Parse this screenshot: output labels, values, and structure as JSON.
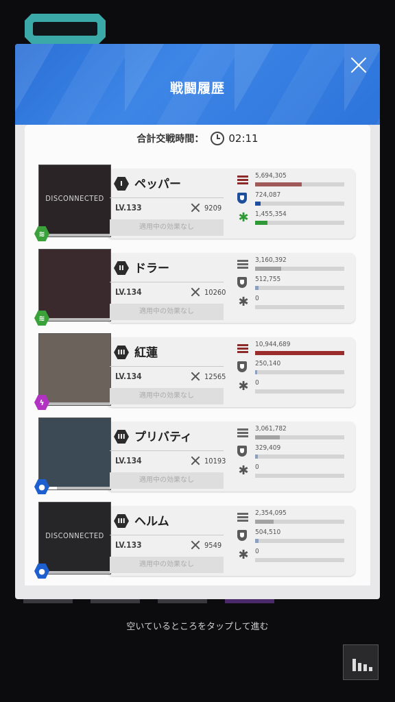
{
  "modal": {
    "title": "戦闘履歴",
    "total_label": "合計交戦時間：",
    "total_time": "02:11"
  },
  "hint": "空いているところをタップして進む",
  "effect_none": "適用中の効果なし",
  "colors": {
    "header_blue": "#2f77dc",
    "damage_top": "#a15a5a",
    "damage_max": "#9b2c2c",
    "defense_top": "#1e4f9c",
    "heal_top": "#2f9a35",
    "bar_gray": "#a3a3a3"
  },
  "units": [
    {
      "rank": "I",
      "name": "ペッパー",
      "level": "LV.133",
      "power": "9209",
      "disconnected": "DISCONNECTED",
      "element": "wind",
      "damage": "5,694,305",
      "damage_ratio": 0.52,
      "defense": "724,087",
      "defense_ratio": 0.06,
      "heal": "1,455,354",
      "heal_ratio": 0.14,
      "effect": "適用中の効果なし"
    },
    {
      "rank": "II",
      "name": "ドラー",
      "level": "LV.134",
      "power": "10260",
      "disconnected": "",
      "element": "wind",
      "damage": "3,160,392",
      "damage_ratio": 0.29,
      "defense": "512,755",
      "defense_ratio": 0.04,
      "heal": "0",
      "heal_ratio": 0,
      "effect": "適用中の効果なし"
    },
    {
      "rank": "III",
      "name": "紅蓮",
      "level": "LV.134",
      "power": "12565",
      "disconnected": "",
      "element": "electric",
      "damage": "10,944,689",
      "damage_ratio": 1.0,
      "defense": "250,140",
      "defense_ratio": 0.02,
      "heal": "0",
      "heal_ratio": 0,
      "effect": "適用中の効果なし"
    },
    {
      "rank": "III",
      "name": "プリバティ",
      "level": "LV.134",
      "power": "10193",
      "disconnected": "",
      "element": "water",
      "damage": "3,061,782",
      "damage_ratio": 0.28,
      "defense": "329,409",
      "defense_ratio": 0.03,
      "heal": "0",
      "heal_ratio": 0,
      "effect": "適用中の効果なし"
    },
    {
      "rank": "III",
      "name": "ヘルム",
      "level": "LV.133",
      "power": "9549",
      "disconnected": "DISCONNECTED",
      "element": "water",
      "damage": "2,354,095",
      "damage_ratio": 0.21,
      "defense": "504,510",
      "defense_ratio": 0.04,
      "heal": "0",
      "heal_ratio": 0,
      "effect": "適用中の効果なし"
    }
  ]
}
